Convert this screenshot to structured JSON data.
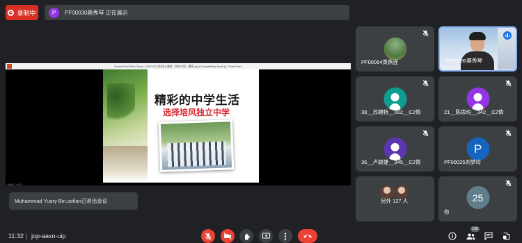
{
  "recording": {
    "label": "录制中"
  },
  "presenting": {
    "avatar_letter": "P",
    "text": "PF00030蔡秀琴 正在展示"
  },
  "presentation": {
    "window_title": "PowerPoint Slide Show - [2022小六生线上课程 - 学校介绍 - 董凤.ppt [Compatibility Mode]] - PowerPoint",
    "slide_title": "精彩的中学生活",
    "slide_subtitle": "选择培风独立中学",
    "slide_counter": "Slide 1 of 13"
  },
  "toast": {
    "text": "Muhammad Yuary Bin.sofian已退出会议"
  },
  "participants": [
    {
      "name": "PF00064黄燕连"
    },
    {
      "name": "PF00030蔡秀琴",
      "speaking": true
    },
    {
      "name": "38__苏翱特__002__C2情",
      "avatar_color": "#0f9d8f"
    },
    {
      "name": "21__陈思均__342__C2情",
      "avatar_color": "#9334e6"
    },
    {
      "name": "36__卢颖捷__345__C2情",
      "avatar_color": "#5e35b1"
    },
    {
      "name": "PF00025刘梦玲",
      "avatar_color": "#1565c0",
      "avatar_letter": "P"
    },
    {
      "name": "另外 127 人"
    },
    {
      "name": "你",
      "avatar_letter": "25",
      "avatar_color": "#607d8b"
    }
  ],
  "bottom_bar": {
    "time": "11:32",
    "separator": "|",
    "meeting_code": "jop-aaxn-uip",
    "participant_count": "135"
  }
}
